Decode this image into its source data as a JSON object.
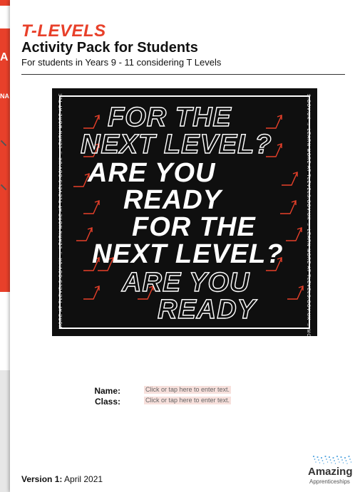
{
  "colors": {
    "brand_orange": "#e8402a",
    "poster_bg": "#0f0f0f",
    "field_bg": "#f7e0dc",
    "amazing_blue": "#5aa8e0"
  },
  "background_doc": {
    "side_text_1": "A",
    "side_text_2": "NA"
  },
  "header": {
    "logo_text": "T-LEVELS",
    "title": "Activity Pack for Students",
    "subtitle": "For students in Years 9 - 11 considering T Levels"
  },
  "poster": {
    "lines": [
      {
        "text": "FOR THE",
        "style": "outline"
      },
      {
        "text": "NEXT LEVEL?",
        "style": "outline"
      },
      {
        "text": "ARE YOU",
        "style": "solid"
      },
      {
        "text": "READY",
        "style": "solid"
      },
      {
        "text": "FOR THE",
        "style": "solid"
      },
      {
        "text": "NEXT LEVEL?",
        "style": "solid"
      },
      {
        "text": "ARE YOU",
        "style": "outline"
      },
      {
        "text": "READY",
        "style": "outline"
      }
    ],
    "side_text_left": "MORE AT TLEVELS.GOV.UK → LEARN MORE AT TLEVELS.GOV.UK → LEARN MORE AT TLE",
    "side_text_right": "S.GOV.UK → LEARN MORE AT TLEVELS.GOV.UK → LEARN MORE AT TLEVELS.GOV.UK → MOR"
  },
  "form": {
    "name_label": "Name:",
    "class_label": "Class:",
    "name_placeholder": "Click or tap here to enter text.",
    "class_placeholder": "Click or tap here to enter text."
  },
  "footer": {
    "version_label": "Version 1:",
    "version_date": "April 2021",
    "amazing_word": "Amazing",
    "amazing_sub": "Apprenticeships"
  }
}
